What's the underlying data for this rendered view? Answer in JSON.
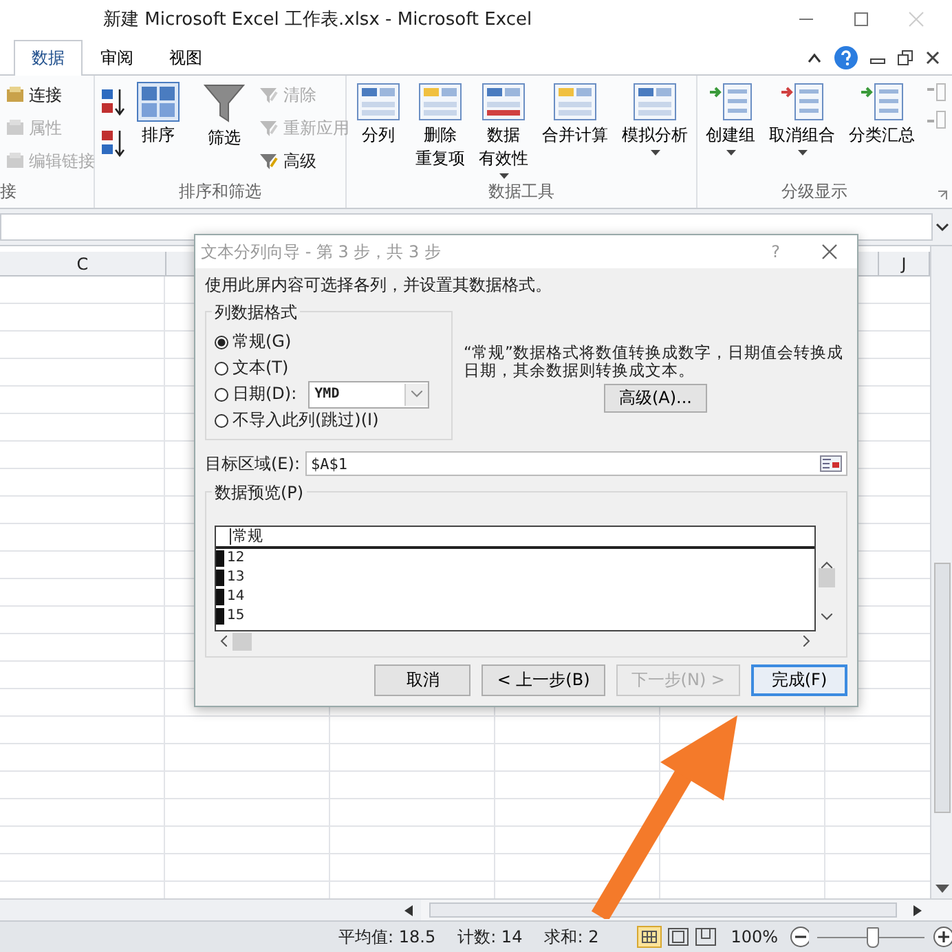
{
  "window": {
    "title": "新建 Microsoft Excel 工作表.xlsx  -  Microsoft Excel"
  },
  "tabs": [
    {
      "label": "数据",
      "selected": true
    },
    {
      "label": "审阅",
      "selected": false
    },
    {
      "label": "视图",
      "selected": false
    }
  ],
  "ribbon": {
    "links": {
      "label": "接",
      "items": [
        {
          "label": "连接",
          "disabled": false
        },
        {
          "label": "属性",
          "disabled": true
        },
        {
          "label": "编辑链接",
          "disabled": true
        }
      ]
    },
    "sort": {
      "label": "排序和筛选",
      "sort_button": "排序",
      "filter_button": "筛选",
      "small": [
        {
          "label": "清除",
          "disabled": true
        },
        {
          "label": "重新应用",
          "disabled": true
        },
        {
          "label": "高级",
          "disabled": false
        }
      ]
    },
    "tools": {
      "label": "数据工具",
      "buttons": [
        {
          "lines": [
            "分列"
          ],
          "dropdown": false
        },
        {
          "lines": [
            "删除",
            "重复项"
          ],
          "dropdown": false
        },
        {
          "lines": [
            "数据",
            "有效性"
          ],
          "dropdown": true
        },
        {
          "lines": [
            "合并计算"
          ],
          "dropdown": false
        },
        {
          "lines": [
            "模拟分析"
          ],
          "dropdown": true
        }
      ]
    },
    "outline": {
      "label": "分级显示",
      "buttons": [
        {
          "label": "创建组",
          "dropdown": true
        },
        {
          "label": "取消组合",
          "dropdown": true
        },
        {
          "label": "分类汇总",
          "dropdown": false
        }
      ]
    }
  },
  "columns": [
    "C",
    "J"
  ],
  "dialog": {
    "title": "文本分列向导 - 第 3 步，共 3 步",
    "help": "?",
    "instruction": "使用此屏内容可选择各列，并设置其数据格式。",
    "format_label": "列数据格式",
    "format_options": [
      {
        "label": "常规(G)",
        "selected": true
      },
      {
        "label": "文本(T)",
        "selected": false
      },
      {
        "label": "日期(D):",
        "selected": false
      },
      {
        "label": "不导入此列(跳过)(I)",
        "selected": false
      }
    ],
    "date_format": "YMD",
    "description": "“常规”数据格式将数值转换成数字，日期值会转换成日期，其余数据则转换成文本。",
    "advanced_button": "高级(A)...",
    "destination": {
      "label": "目标区域(E):",
      "value": "$A$1"
    },
    "preview": {
      "label": "数据预览(P)",
      "header": "常规",
      "rows": [
        "12",
        "13",
        "14",
        "15"
      ]
    },
    "buttons": [
      {
        "label": "取消",
        "disabled": false,
        "default": false
      },
      {
        "label": "< 上一步(B)",
        "disabled": false,
        "default": false
      },
      {
        "label": "下一步(N) >",
        "disabled": true,
        "default": false
      },
      {
        "label": "完成(F)",
        "disabled": false,
        "default": true
      }
    ]
  },
  "status_bar": {
    "stats": [
      "平均值: 18.5",
      "计数: 14",
      "求和: 2"
    ],
    "zoom": "100%",
    "zoom_slider": {
      "level": 0.5
    }
  }
}
